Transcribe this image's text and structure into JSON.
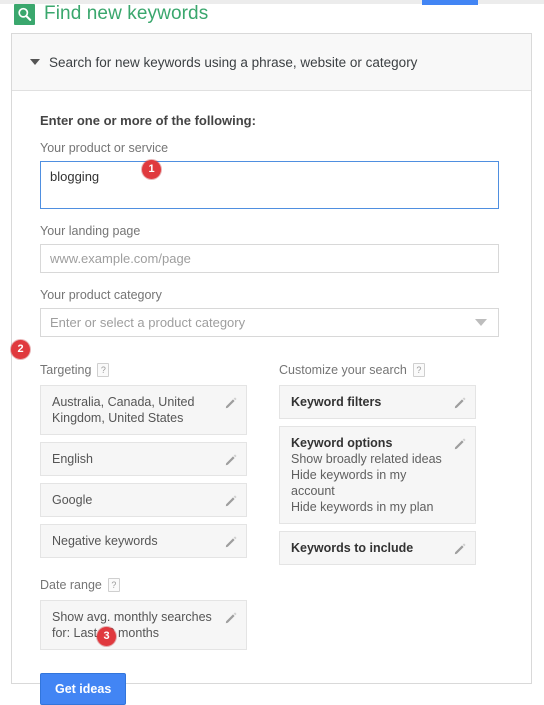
{
  "header": {
    "icon": "keyword-planner-search-icon",
    "title": "Find new keywords",
    "title_color": "#3aa76d",
    "accent_blue": "#4285f4"
  },
  "panel": {
    "collapse_icon": "caret-down-icon",
    "header_text": "Search for new keywords using a phrase, website or category"
  },
  "form": {
    "intro": "Enter one or more of the following:",
    "product_or_service": {
      "label": "Your product or service",
      "value": "blogging"
    },
    "landing_page": {
      "label": "Your landing page",
      "placeholder": "www.example.com/page",
      "value": ""
    },
    "product_category": {
      "label": "Your product category",
      "placeholder": "Enter or select a product category",
      "value": "",
      "caret": "chevron-down-icon"
    }
  },
  "targeting": {
    "title": "Targeting",
    "help": "?",
    "tiles": [
      {
        "title": "Australia, Canada, United Kingdom, United States",
        "edit": "pencil-icon"
      },
      {
        "title": "English",
        "edit": "pencil-icon"
      },
      {
        "title": "Google",
        "edit": "pencil-icon"
      },
      {
        "title": "Negative keywords",
        "edit": "pencil-icon"
      }
    ]
  },
  "date_range": {
    "title": "Date range",
    "help": "?",
    "tile": {
      "title": "Show avg. monthly searches for: Last 12 months",
      "edit": "pencil-icon"
    }
  },
  "customize": {
    "title": "Customize your search",
    "help": "?",
    "tiles": [
      {
        "title": "Keyword filters",
        "options": [],
        "edit": "pencil-icon"
      },
      {
        "title": "Keyword options",
        "options": [
          "Show broadly related ideas",
          "Hide keywords in my account",
          "Hide keywords in my plan"
        ],
        "edit": "pencil-icon"
      },
      {
        "title": "Keywords to include",
        "options": [],
        "edit": "pencil-icon"
      }
    ]
  },
  "actions": {
    "get_ideas_label": "Get ideas"
  },
  "annotations": {
    "badge1": "1",
    "badge2": "2",
    "badge3": "3",
    "badge_color": "#e0393e"
  }
}
